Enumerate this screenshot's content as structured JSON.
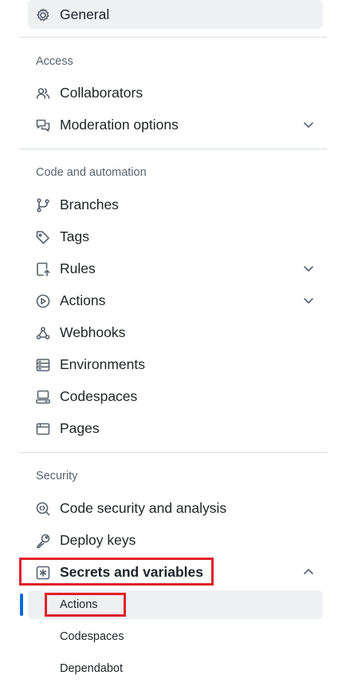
{
  "nav": {
    "general": "General",
    "sections": {
      "access": "Access",
      "code_automation": "Code and automation",
      "security": "Security"
    },
    "access_items": {
      "collaborators": "Collaborators",
      "moderation": "Moderation options"
    },
    "code_items": {
      "branches": "Branches",
      "tags": "Tags",
      "rules": "Rules",
      "actions": "Actions",
      "webhooks": "Webhooks",
      "environments": "Environments",
      "codespaces": "Codespaces",
      "pages": "Pages"
    },
    "security_items": {
      "code_security": "Code security and analysis",
      "deploy_keys": "Deploy keys",
      "secrets": "Secrets and variables"
    },
    "secrets_sub": {
      "actions": "Actions",
      "codespaces": "Codespaces",
      "dependabot": "Dependabot"
    }
  },
  "colors": {
    "highlight": "#e0202a",
    "active_indicator": "#0969da",
    "selected_bg": "#eef0f2"
  }
}
